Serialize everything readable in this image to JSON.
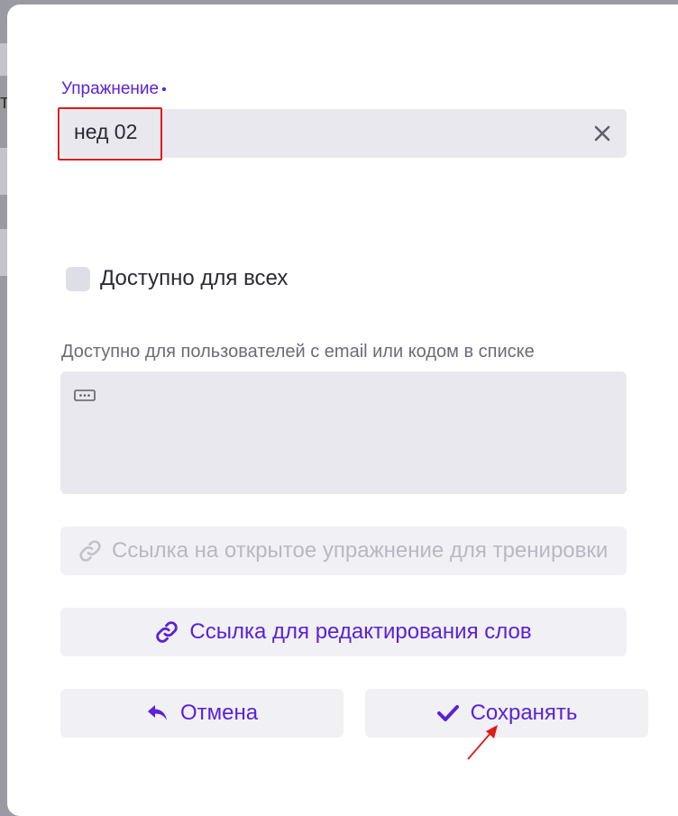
{
  "form": {
    "exercise_label": "Упражнение",
    "required_marker": "•",
    "exercise_value": "нед 02",
    "public_checkbox_label": "Доступно для всех",
    "access_list_label": "Доступно для пользователей с email или кодом в списке",
    "open_link_placeholder": "Ссылка на открытое упражнение для тренировки",
    "edit_link_label": "Ссылка для редактирования слов"
  },
  "actions": {
    "cancel_label": "Отмена",
    "save_label": "Сохранять"
  },
  "background": {
    "peek_glyph": "т"
  },
  "colors": {
    "accent": "#5b21d6",
    "highlight": "#e01a1a"
  }
}
